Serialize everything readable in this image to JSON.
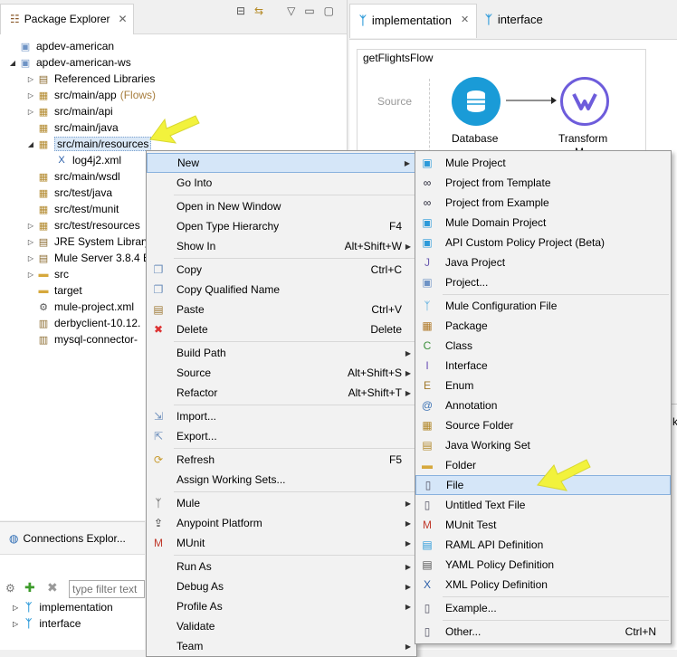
{
  "package_explorer": {
    "tab_label": "Package Explorer",
    "tree": [
      {
        "label": "apdev-american",
        "icon": "project-icon",
        "twisty": ""
      },
      {
        "label": "apdev-american-ws",
        "icon": "project-icon",
        "twisty": "◢"
      },
      {
        "label": "Referenced Libraries",
        "icon": "library-icon",
        "twisty": "▷"
      },
      {
        "label": "src/main/app",
        "suffix": "(Flows)",
        "icon": "package-folder-icon",
        "twisty": "▷"
      },
      {
        "label": "src/main/api",
        "icon": "package-folder-icon",
        "twisty": "▷"
      },
      {
        "label": "src/main/java",
        "icon": "package-folder-icon",
        "twisty": ""
      },
      {
        "label": "src/main/resources",
        "icon": "package-folder-icon",
        "twisty": "◢"
      },
      {
        "label": "log4j2.xml",
        "icon": "xml-file-icon",
        "twisty": ""
      },
      {
        "label": "src/main/wsdl",
        "icon": "package-folder-icon",
        "twisty": ""
      },
      {
        "label": "src/test/java",
        "icon": "package-folder-icon",
        "twisty": ""
      },
      {
        "label": "src/test/munit",
        "icon": "package-folder-icon",
        "twisty": ""
      },
      {
        "label": "src/test/resources",
        "icon": "package-folder-icon",
        "twisty": "▷"
      },
      {
        "label": "JRE System Library",
        "icon": "library-icon",
        "twisty": "▷"
      },
      {
        "label": "Mule Server 3.8.4 E",
        "icon": "library-icon",
        "twisty": "▷"
      },
      {
        "label": "src",
        "icon": "folder-icon",
        "twisty": "▷"
      },
      {
        "label": "target",
        "icon": "folder-icon",
        "twisty": ""
      },
      {
        "label": "mule-project.xml",
        "icon": "gear-icon",
        "twisty": ""
      },
      {
        "label": "derbyclient-10.12.",
        "icon": "jar-icon",
        "twisty": ""
      },
      {
        "label": "mysql-connector-",
        "icon": "jar-icon",
        "twisty": ""
      }
    ]
  },
  "connections": {
    "tab_label": "Connections Explor...",
    "filter_placeholder": "type filter text",
    "items": [
      "implementation",
      "interface"
    ]
  },
  "editor": {
    "tabs": [
      "implementation",
      "interface"
    ],
    "flow_name": "getFlightsFlow",
    "source_label": "Source",
    "nodes": [
      "Database",
      "Transform"
    ],
    "transform_cut": "M",
    "clipped_char": "k"
  },
  "context_menu": [
    {
      "label": "New",
      "submenu": true,
      "highlight": true
    },
    {
      "label": "Go Into"
    },
    {
      "sep": true
    },
    {
      "label": "Open in New Window"
    },
    {
      "label": "Open Type Hierarchy",
      "acc": "F4"
    },
    {
      "label": "Show In",
      "acc": "Alt+Shift+W",
      "submenu": true
    },
    {
      "sep": true
    },
    {
      "label": "Copy",
      "acc": "Ctrl+C",
      "icon": "copy-icon"
    },
    {
      "label": "Copy Qualified Name",
      "icon": "copy-icon"
    },
    {
      "label": "Paste",
      "acc": "Ctrl+V",
      "icon": "paste-icon"
    },
    {
      "label": "Delete",
      "acc": "Delete",
      "icon": "delete-icon"
    },
    {
      "sep": true
    },
    {
      "label": "Build Path",
      "submenu": true
    },
    {
      "label": "Source",
      "acc": "Alt+Shift+S",
      "submenu": true
    },
    {
      "label": "Refactor",
      "acc": "Alt+Shift+T",
      "submenu": true
    },
    {
      "sep": true
    },
    {
      "label": "Import...",
      "icon": "import-icon"
    },
    {
      "label": "Export...",
      "icon": "export-icon"
    },
    {
      "sep": true
    },
    {
      "label": "Refresh",
      "acc": "F5",
      "icon": "refresh-icon"
    },
    {
      "label": "Assign Working Sets..."
    },
    {
      "sep": true
    },
    {
      "label": "Mule",
      "submenu": true,
      "icon": "mule-icon"
    },
    {
      "label": "Anypoint Platform",
      "submenu": true,
      "icon": "upload-icon"
    },
    {
      "label": "MUnit",
      "submenu": true,
      "icon": "munit-icon"
    },
    {
      "sep": true
    },
    {
      "label": "Run As",
      "submenu": true
    },
    {
      "label": "Debug As",
      "submenu": true
    },
    {
      "label": "Profile As",
      "submenu": true
    },
    {
      "label": "Validate"
    },
    {
      "label": "Team",
      "submenu": true
    }
  ],
  "new_submenu": [
    {
      "label": "Mule Project",
      "icon": "mule-project-icon"
    },
    {
      "label": "Project from Template",
      "icon": "template-icon"
    },
    {
      "label": "Project from Example",
      "icon": "template-icon"
    },
    {
      "label": "Mule Domain Project",
      "icon": "domain-project-icon"
    },
    {
      "label": "API Custom Policy Project (Beta)",
      "icon": "policy-project-icon"
    },
    {
      "label": "Java Project",
      "icon": "java-project-icon"
    },
    {
      "label": "Project...",
      "icon": "project-icon"
    },
    {
      "sep": true
    },
    {
      "label": "Mule Configuration File",
      "icon": "mule-config-icon"
    },
    {
      "label": "Package",
      "icon": "package-icon"
    },
    {
      "label": "Class",
      "icon": "class-icon"
    },
    {
      "label": "Interface",
      "icon": "interface-icon"
    },
    {
      "label": "Enum",
      "icon": "enum-icon"
    },
    {
      "label": "Annotation",
      "icon": "annotation-icon"
    },
    {
      "label": "Source Folder",
      "icon": "source-folder-icon"
    },
    {
      "label": "Java Working Set",
      "icon": "working-set-icon"
    },
    {
      "label": "Folder",
      "icon": "folder-icon"
    },
    {
      "label": "File",
      "icon": "file-icon",
      "highlight": true
    },
    {
      "label": "Untitled Text File",
      "icon": "text-file-icon"
    },
    {
      "label": "MUnit Test",
      "icon": "munit-icon"
    },
    {
      "label": "RAML API Definition",
      "icon": "raml-icon"
    },
    {
      "label": "YAML Policy Definition",
      "icon": "yaml-icon"
    },
    {
      "label": "XML Policy Definition",
      "icon": "xml-icon"
    },
    {
      "sep": true
    },
    {
      "label": "Example...",
      "icon": "example-icon"
    },
    {
      "sep": true
    },
    {
      "label": "Other...",
      "acc": "Ctrl+N",
      "icon": "other-icon"
    }
  ],
  "colors": {
    "selection": "#d5e6f8",
    "selection_border": "#88b1de",
    "arrow": "#f2f23c",
    "database": "#1a9bd7",
    "transform": "#6d5cdb"
  }
}
